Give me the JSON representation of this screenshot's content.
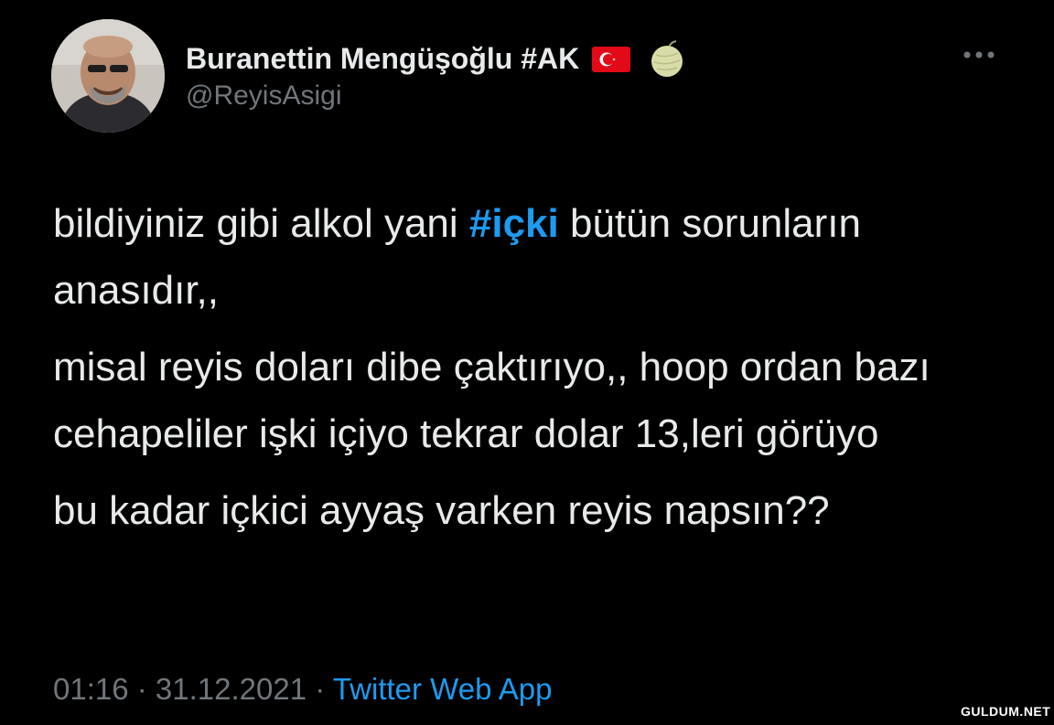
{
  "tweet": {
    "author": {
      "display_name": "Buranettin Mengüşoğlu #AK",
      "handle": "@ReyisAsigi",
      "avatar_icon": "profile-photo",
      "badges": [
        "turkey-flag-icon",
        "melon-icon"
      ]
    },
    "more_icon": "ellipsis-icon",
    "paragraphs": [
      {
        "before": "bildiyiniz gibi alkol yani ",
        "hashtag": "#içki",
        "after": " bütün sorunların anasıdır,,"
      },
      {
        "text": "misal reyis doları dibe çaktırıyo,, hoop ordan bazı cehapeliler işki içiyo tekrar dolar 13,leri görüyo"
      },
      {
        "text": "bu kadar içkici ayyaş varken reyis napsın??"
      }
    ],
    "meta": {
      "time": "01:16",
      "separator": " · ",
      "date": "31.12.2021",
      "source": "Twitter Web App"
    }
  },
  "watermark": "GULDUM.NET",
  "colors": {
    "background": "#000000",
    "text": "#e7e9ea",
    "secondary": "#71767b",
    "link": "#1d9bf0"
  }
}
